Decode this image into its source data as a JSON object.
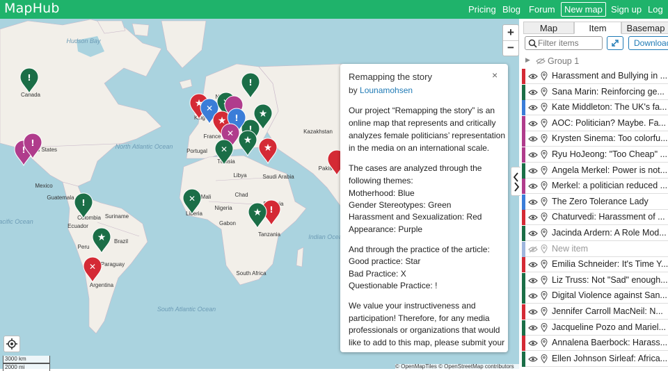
{
  "app": {
    "name": "MapHub"
  },
  "nav": {
    "pricing": "Pricing",
    "blog": "Blog",
    "forum": "Forum",
    "new_map": "New map",
    "sign_up": "Sign up",
    "log_in": "Log in"
  },
  "map": {
    "zoom_in": "+",
    "zoom_out": "−",
    "scale_km": "3000 km",
    "scale_mi": "2000 mi",
    "attribution": "© OpenMapTiles © OpenStreetMap contributors",
    "labels": {
      "canada": "Canada",
      "united_states": "United States",
      "mexico": "Mexico",
      "guatemala": "Guatemala",
      "colombia": "Colombia",
      "ecuador": "Ecuador",
      "suriname": "Suriname",
      "peru": "Peru",
      "brazil": "Brazil",
      "paraguay": "Paraguay",
      "argentina": "Argentina",
      "hudson_bay": "Hudson Bay",
      "north_atlantic_ocean": "North Atlantic Ocean",
      "south_atlantic_ocean": "South Atlantic Ocean",
      "pacific_ocean": "Pacific Ocean",
      "indian_ocean": "Indian Ocean",
      "norway": "Norway",
      "france": "France",
      "portugal": "Portugal",
      "tunisia": "Tunisia",
      "libya": "Libya",
      "mali": "Mali",
      "chad": "Chad",
      "nigeria": "Nigeria",
      "liberia": "Liberia",
      "gabon": "Gabon",
      "ethiopia": "Ethiopia",
      "tanzania": "Tanzania",
      "south_africa": "South Africa",
      "kazakhstan": "Kazakhstan",
      "saudi_arabia": "Saudi Arabia",
      "pakistan": "Pakistan",
      "kingdom": "King"
    },
    "colors": {
      "blue": "#3b7dd8",
      "green": "#1b6e47",
      "red": "#d42a35",
      "purple": "#b03c8c"
    }
  },
  "popup": {
    "title": "Remapping the story",
    "by": "by ",
    "author": "Lounamohsen",
    "close": "×",
    "lines": [
      "Our project “Remapping the story” is an",
      "online map that represents and critically",
      "analyzes female politicians’ representation",
      "in the media on an international scale.",
      "The cases are analyzed through the",
      "following themes:",
      "Motherhood: Blue",
      "Gender Stereotypes: Green",
      "Harassment and Sexualization: Red",
      "Appearance: Purple",
      "And through the practice of the article:",
      "Good practice: Star",
      "Bad Practice: X",
      "Questionable Practice: !",
      "We value your instructiveness and",
      "participation! Therefore, for any media",
      "professionals or organizations that would",
      "like to add to this map, please submit your"
    ]
  },
  "panel": {
    "tabs": [
      "Map",
      "Item",
      "Basemap"
    ],
    "filter_placeholder": "Filter items",
    "download": "Download",
    "group": "Group 1",
    "items": [
      {
        "title": "Harassment and Bullying in ...",
        "color": "#d42a35"
      },
      {
        "title": "Sana Marin: Reinforcing ge...",
        "color": "#1b6e47"
      },
      {
        "title": "Kate Middleton: The UK's fa...",
        "color": "#3b7dd8"
      },
      {
        "title": "AOC: Politician? Maybe. Fa...",
        "color": "#b03c8c"
      },
      {
        "title": "Krysten Sinema: Too colorfu...",
        "color": "#b03c8c"
      },
      {
        "title": "Ryu HoJeong: \"Too Cheap\" ...",
        "color": "#b03c8c"
      },
      {
        "title": "Angela Merkel: Power is not...",
        "color": "#1b6e47"
      },
      {
        "title": "Merkel: a politician reduced ...",
        "color": "#b03c8c"
      },
      {
        "title": "The Zero Tolerance Lady",
        "color": "#3b7dd8"
      },
      {
        "title": "Chaturvedi: Harassment of ...",
        "color": "#d42a35"
      },
      {
        "title": "Jacinda Ardern: A Role Mod...",
        "color": "#1b6e47"
      },
      {
        "title": "New item",
        "color": "#9fb6dd",
        "dim": true
      },
      {
        "title": "Emilia Schneider: It's Time Y...",
        "color": "#d42a35"
      },
      {
        "title": "Liz Truss: Not \"Sad\" enough...",
        "color": "#1b6e47"
      },
      {
        "title": "Digital Violence against San...",
        "color": "#1b6e47"
      },
      {
        "title": "Jennifer Carroll MacNeil: N...",
        "color": "#d42a35"
      },
      {
        "title": "Jacqueline Pozo and Mariel...",
        "color": "#1b6e47"
      },
      {
        "title": "Annalena Baerbock: Harass...",
        "color": "#d42a35"
      },
      {
        "title": "Ellen Johnson Sirleaf: Africa...",
        "color": "#1b6e47"
      }
    ]
  }
}
